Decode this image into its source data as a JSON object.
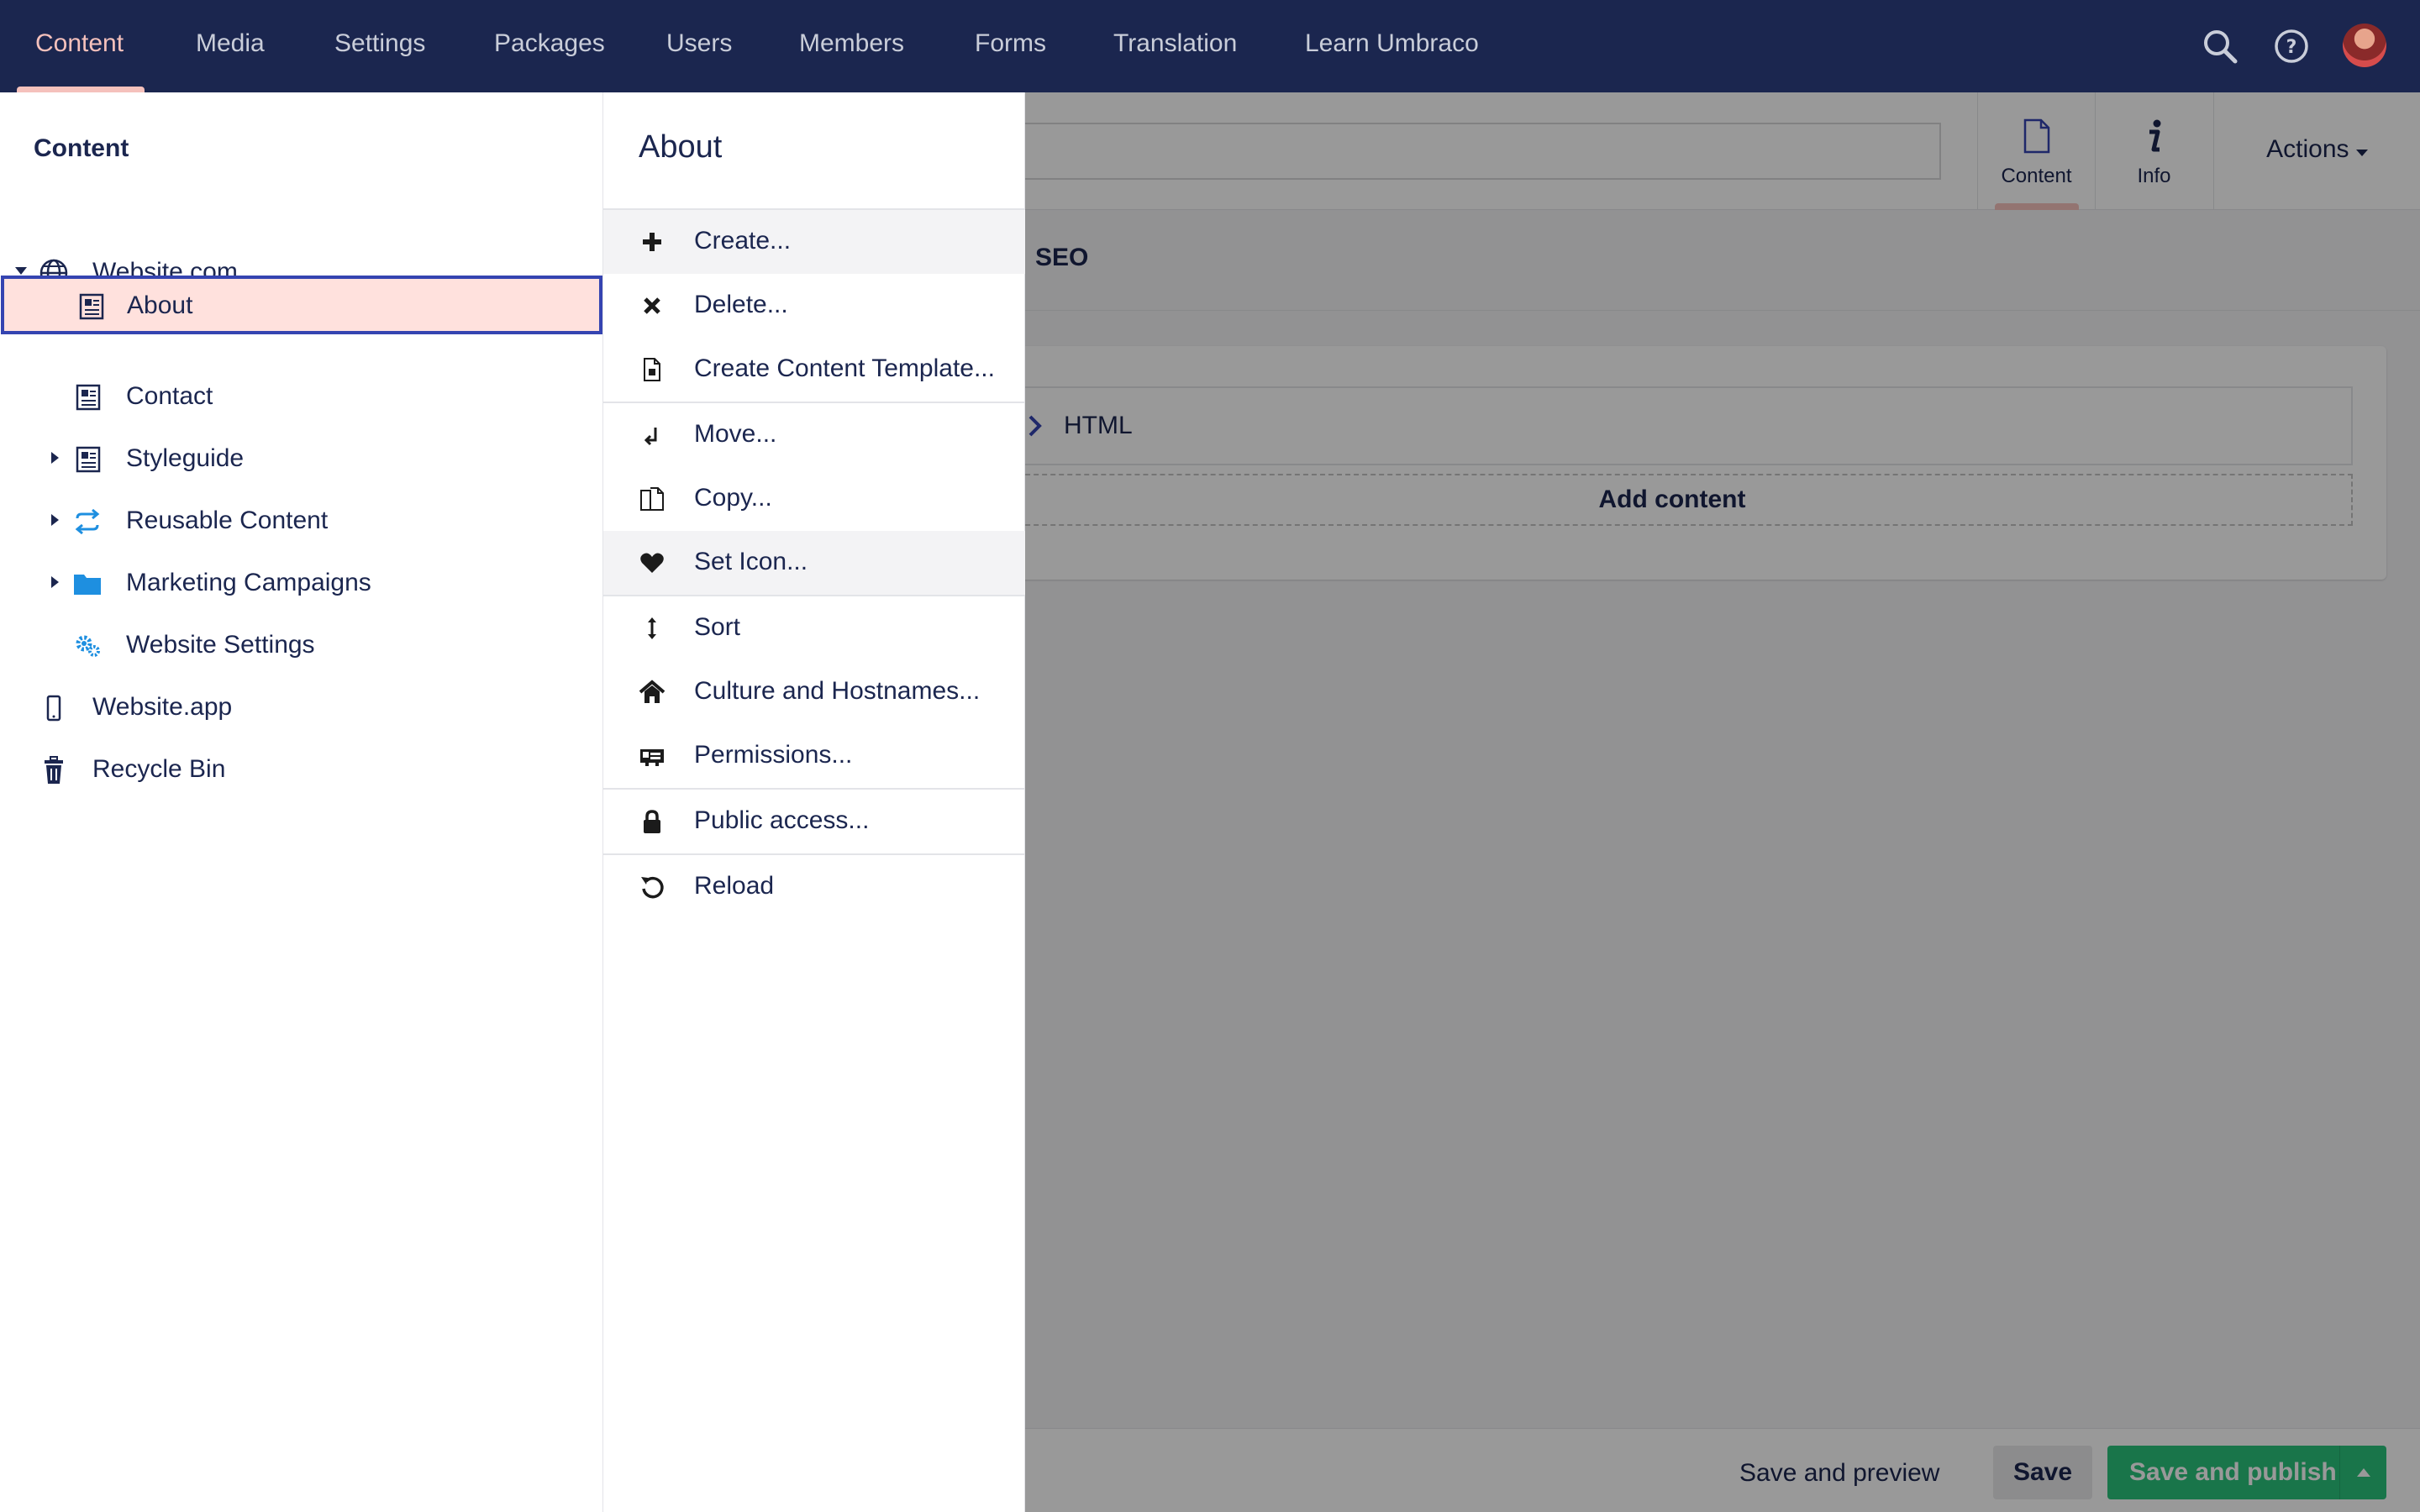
{
  "topnav": {
    "items": [
      "Content",
      "Media",
      "Settings",
      "Packages",
      "Users",
      "Members",
      "Forms",
      "Translation",
      "Learn Umbraco"
    ],
    "active": "Content",
    "icons": [
      "search-icon",
      "help-icon",
      "avatar"
    ]
  },
  "tree": {
    "title": "Content",
    "items": [
      {
        "label": "Website.com",
        "icon": "globe-icon",
        "expanded": true
      },
      {
        "label": "About",
        "icon": "document-icon",
        "selected": true
      },
      {
        "label": "Contact",
        "icon": "document-icon"
      },
      {
        "label": "Styleguide",
        "icon": "document-icon",
        "has_children": true
      },
      {
        "label": "Reusable Content",
        "icon": "sync-icon",
        "has_children": true
      },
      {
        "label": "Marketing Campaigns",
        "icon": "folder-icon",
        "has_children": true
      },
      {
        "label": "Website Settings",
        "icon": "settings-icon"
      },
      {
        "label": "Website.app",
        "icon": "mobile-icon"
      },
      {
        "label": "Recycle Bin",
        "icon": "trash-icon"
      }
    ]
  },
  "menu": {
    "title": "About",
    "items": [
      {
        "label": "Create...",
        "icon": "plus-icon"
      },
      {
        "label": "Delete...",
        "icon": "delete-x-icon"
      },
      {
        "label": "Create Content Template...",
        "icon": "template-icon"
      },
      {
        "label": "Move...",
        "icon": "move-icon"
      },
      {
        "label": "Copy...",
        "icon": "copy-icon"
      },
      {
        "label": "Set Icon...",
        "icon": "heart-icon"
      },
      {
        "label": "Sort",
        "icon": "sort-icon"
      },
      {
        "label": "Culture and Hostnames...",
        "icon": "home-icon"
      },
      {
        "label": "Permissions...",
        "icon": "permissions-icon"
      },
      {
        "label": "Public access...",
        "icon": "lock-icon"
      },
      {
        "label": "Reload",
        "icon": "reload-icon"
      }
    ]
  },
  "editor": {
    "apps": [
      {
        "label": "Content",
        "icon": "document-icon",
        "active": true
      },
      {
        "label": "Info",
        "icon": "info-icon"
      }
    ],
    "actions_label": "Actions",
    "tabs": [
      "SEO"
    ],
    "block": {
      "label": "HTML"
    },
    "add_content": "Add content"
  },
  "footer": {
    "save_preview": "Save and preview",
    "save": "Save",
    "save_publish": "Save and publish"
  },
  "colors": {
    "nav_bg": "#1b264f",
    "nav_active": "#f5c1bc",
    "selected_bg": "#ffe1dd",
    "selected_border": "#3544b1",
    "publish_green": "#2bc37c",
    "tree_icon_blue": "#1e8fe0"
  }
}
